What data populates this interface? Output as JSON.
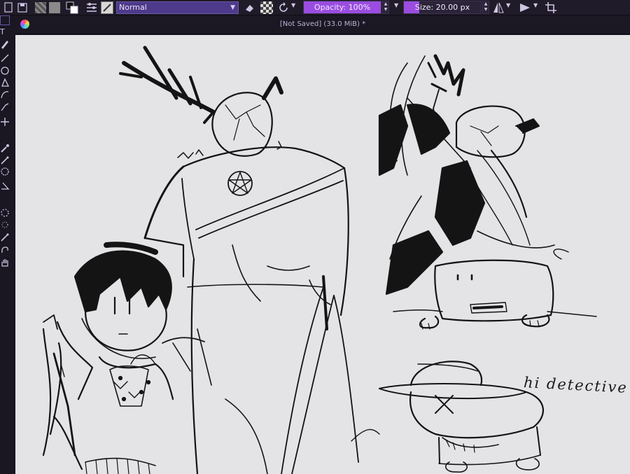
{
  "toolbar": {
    "blend_mode": "Normal",
    "opacity_label": "Opacity: 100%",
    "opacity_value": 1.0,
    "size_label": "Size: 20.00 px",
    "size_value": 0.2,
    "foreground_color": "#3a3a3a",
    "background_color": "#8a8a8a"
  },
  "document": {
    "title": "[Not Saved]  (33.0 MiB) *"
  },
  "canvas": {
    "handwritten_text": "hi detective"
  },
  "colors": {
    "accent": "#9a4de0",
    "select_bg": "#4e3a8a",
    "canvas_bg": "#e4e3e6",
    "chrome_bg": "#201b29"
  }
}
